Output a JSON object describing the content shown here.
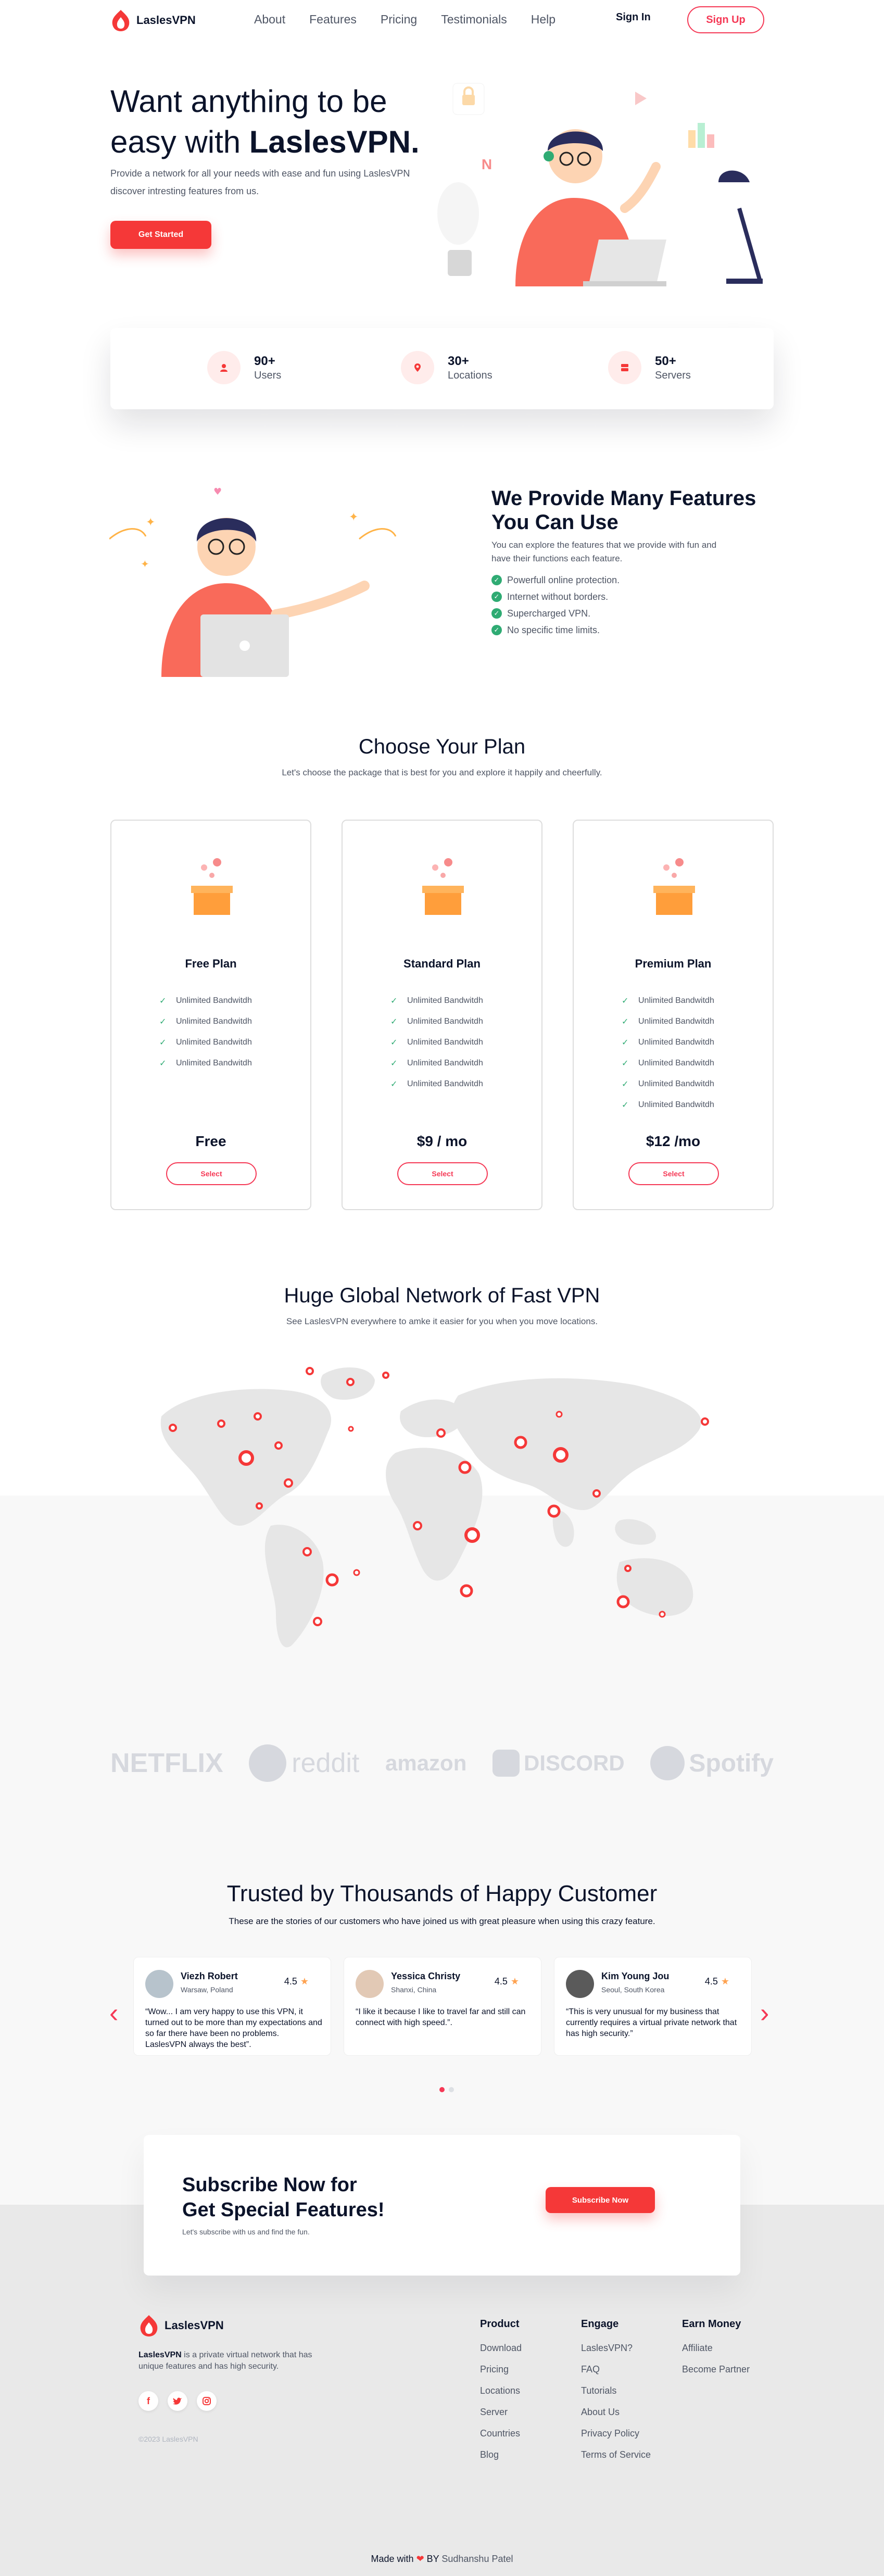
{
  "nav": {
    "brand": "LaslesVPN",
    "links": [
      "About",
      "Features",
      "Pricing",
      "Testimonials",
      "Help"
    ],
    "sign_in": "Sign In",
    "sign_up": "Sign Up"
  },
  "hero": {
    "title_line1": "Want anything to be",
    "title_line2_pre": "easy with ",
    "title_line2_brand": "LaslesVPN.",
    "description": "Provide a network for all your needs with ease and fun using LaslesVPN discover intresting features from us.",
    "cta": "Get Started"
  },
  "stats": [
    {
      "value": "90+",
      "label": "Users",
      "icon": "user-icon"
    },
    {
      "value": "30+",
      "label": "Locations",
      "icon": "location-icon"
    },
    {
      "value": "50+",
      "label": "Servers",
      "icon": "server-icon"
    }
  ],
  "features": {
    "title": "We Provide Many Features You Can Use",
    "description": "You can explore the features that we provide with fun and have their functions each feature.",
    "items": [
      "Powerfull online protection.",
      "Internet without borders.",
      "Supercharged VPN.",
      "No specific time limits."
    ]
  },
  "plans": {
    "title": "Choose Your Plan",
    "subtitle": "Let's choose the package that is best for you and explore it happily and cheerfully.",
    "cards": [
      {
        "name": "Free Plan",
        "features": [
          "Unlimited Bandwitdh",
          "Unlimited Bandwitdh",
          "Unlimited Bandwitdh",
          "Unlimited Bandwitdh"
        ],
        "price": "Free",
        "button": "Select"
      },
      {
        "name": "Standard Plan",
        "features": [
          "Unlimited Bandwitdh",
          "Unlimited Bandwitdh",
          "Unlimited Bandwitdh",
          "Unlimited Bandwitdh",
          "Unlimited Bandwitdh"
        ],
        "price": "$9 / mo",
        "button": "Select"
      },
      {
        "name": "Premium Plan",
        "features": [
          "Unlimited Bandwitdh",
          "Unlimited Bandwitdh",
          "Unlimited Bandwitdh",
          "Unlimited Bandwitdh",
          "Unlimited Bandwitdh",
          "Unlimited Bandwitdh"
        ],
        "price": "$12 /mo",
        "button": "Select"
      }
    ]
  },
  "network": {
    "title": "Huge Global Network of Fast VPN",
    "subtitle": "See LaslesVPN everywhere to amke it easier for you when you move locations."
  },
  "brands": [
    "NETFLIX",
    "reddit",
    "amazon",
    "DISCORD",
    "Spotify"
  ],
  "testimonials": {
    "title": "Trusted by Thousands of Happy Customer",
    "subtitle": "These are the stories of our customers who have joined us with great pleasure when using this crazy feature.",
    "cards": [
      {
        "name": "Viezh Robert",
        "location": "Warsaw, Poland",
        "rating": "4.5",
        "text": "“Wow... I am very happy to use this VPN, it turned out to be more than my expectations and so far there have been no problems. LaslesVPN always the best”."
      },
      {
        "name": "Yessica Christy",
        "location": "Shanxi, China",
        "rating": "4.5",
        "text": "“I like it because I like to travel far and still can connect with high speed.”."
      },
      {
        "name": "Kim Young Jou",
        "location": "Seoul, South Korea",
        "rating": "4.5",
        "text": "“This is very unusual for my business that currently requires a virtual private network that has high security.”"
      }
    ]
  },
  "subscribe": {
    "title_line1": "Subscribe Now for",
    "title_line2": "Get Special Features!",
    "description": "Let's subscribe with us and find the fun.",
    "button": "Subscribe Now"
  },
  "footer": {
    "brand": "LaslesVPN",
    "desc_brand": "LaslesVPN",
    "desc_rest": " is a private virtual network that has unique features and has high security.",
    "copyright": "©2023 LaslesVPN",
    "columns": [
      {
        "title": "Product",
        "links": [
          "Download",
          "Pricing",
          "Locations",
          "Server",
          "Countries",
          "Blog"
        ]
      },
      {
        "title": "Engage",
        "links": [
          "LaslesVPN?",
          "FAQ",
          "Tutorials",
          "About Us",
          "Privacy Policy",
          "Terms of Service"
        ]
      },
      {
        "title": "Earn Money",
        "links": [
          "Affiliate",
          "Become Partner"
        ]
      }
    ],
    "made_pre": "Made with",
    "made_by": "BY",
    "author": "Sudhanshu Patel"
  },
  "colors": {
    "accent": "#f53838",
    "dark": "#0b132a",
    "text": "#4f5665",
    "green": "#2fab73"
  }
}
